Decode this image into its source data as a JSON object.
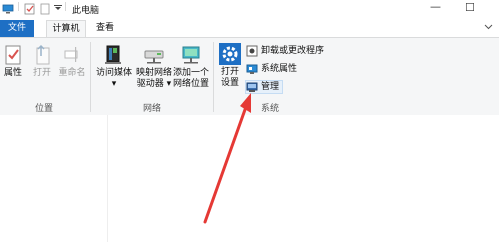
{
  "window": {
    "title": "此电脑",
    "controls": {
      "minimize": "—",
      "maximize": "☐"
    }
  },
  "tabs": [
    {
      "label": "文件"
    },
    {
      "label": "计算机"
    },
    {
      "label": "查看"
    }
  ],
  "ribbon": {
    "location_group": {
      "label": "位置",
      "buttons": [
        {
          "label": "属性"
        },
        {
          "label": "打开"
        },
        {
          "label": "重命名"
        }
      ]
    },
    "network_group": {
      "label": "网络",
      "buttons": [
        {
          "label_line1": "访问媒体",
          "label_line2": "▾"
        },
        {
          "label_line1": "映射网络",
          "label_line2": "驱动器 ▾"
        },
        {
          "label_line1": "添加一个",
          "label_line2": "网络位置"
        }
      ]
    },
    "system_group": {
      "label": "系统",
      "open_settings": {
        "label_line1": "打开",
        "label_line2": "设置"
      },
      "small_buttons": [
        {
          "label": "卸载或更改程序"
        },
        {
          "label": "系统属性"
        },
        {
          "label": "管理"
        }
      ]
    }
  },
  "colors": {
    "accent": "#1e6fc4",
    "arrow": "#e53935",
    "ribbon_bg": "#f5f6f7"
  }
}
